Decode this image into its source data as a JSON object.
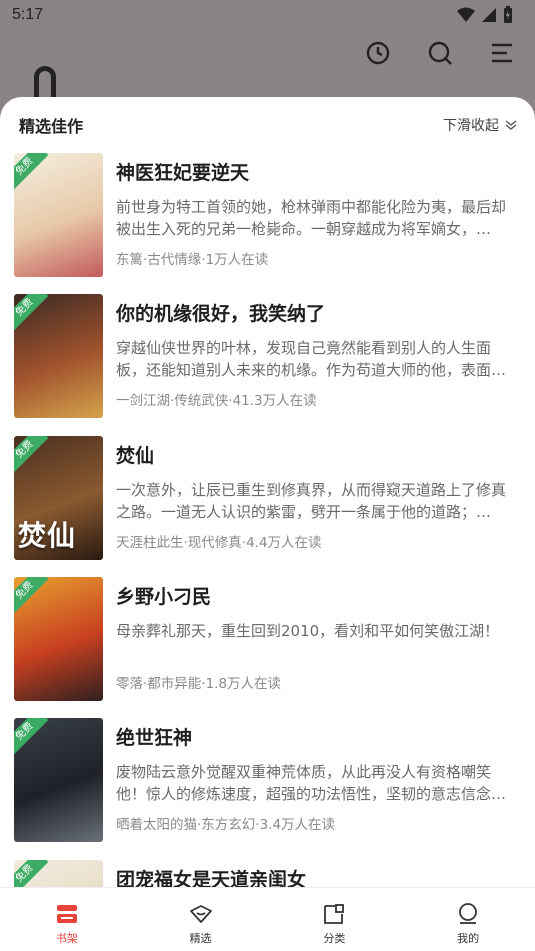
{
  "status_bar": {
    "time": "5:17"
  },
  "sheet": {
    "title": "精选佳作",
    "collapse_label": "下滑收起"
  },
  "books": [
    {
      "title": "神医狂妃要逆天",
      "description": "前世身为特工首领的她，枪林弹雨中都能化险为夷，最后却被出生入死的兄弟一枪毙命。一朝穿越成为将军嫡女，…",
      "meta": "东篱·古代情缘·1万人在读",
      "badge": "免费",
      "cover_text": "",
      "cover_colors": [
        "#f4efe0",
        "#e8c9a8",
        "#c25a5a"
      ]
    },
    {
      "title": "你的机缘很好，我笑纳了",
      "description": "穿越仙侠世界的叶林，发现自己竟然能看到别人的人生面板，还能知道别人未来的机缘。作为苟道大师的他，表面…",
      "meta": "一剑江湖·传统武侠·41.3万人在读",
      "badge": "免费",
      "cover_text": "",
      "cover_colors": [
        "#3b2a24",
        "#a0522d",
        "#d4a24c"
      ]
    },
    {
      "title": "焚仙",
      "description": "一次意外，让辰已重生到修真界，从而得窥天道路上了修真之路。一道无人认识的紫雷，劈开一条属于他的道路；…",
      "meta": "天涯柱此生·现代修真·4.4万人在读",
      "badge": "免费",
      "cover_text": "焚仙",
      "cover_colors": [
        "#4a3020",
        "#8a5a30",
        "#2a1a12"
      ]
    },
    {
      "title": "乡野小刁民",
      "description": "母亲葬礼那天，重生回到2010，看刘和平如何笑傲江湖！",
      "meta": "零落·都市异能·1.8万人在读",
      "badge": "免费",
      "cover_text": "",
      "cover_colors": [
        "#e8a030",
        "#c84020",
        "#302020"
      ]
    },
    {
      "title": "绝世狂神",
      "description": "废物陆云意外觉醒双重神荒体质，从此再没人有资格嘲笑他！惊人的修炼速度，超强的功法悟性，坚韧的意志信念…",
      "meta": "晒着太阳的猫·东方玄幻·3.4万人在读",
      "badge": "免费",
      "cover_text": "",
      "cover_colors": [
        "#3a4048",
        "#1e2228",
        "#6a7078"
      ]
    },
    {
      "title": "团宠福女是天道亲闺女",
      "description": "",
      "meta": "",
      "badge": "免费",
      "cover_text": "",
      "cover_colors": [
        "#f2ece0",
        "#e6d8c0",
        "#d0b890"
      ]
    }
  ],
  "bottom_nav": [
    {
      "label": "书架",
      "icon": "bookshelf-icon",
      "active": true
    },
    {
      "label": "精选",
      "icon": "featured-icon",
      "active": false
    },
    {
      "label": "分类",
      "icon": "category-icon",
      "active": false
    },
    {
      "label": "我的",
      "icon": "profile-icon",
      "active": false
    }
  ],
  "colors": {
    "accent": "#e8443c",
    "badge_green": "#3cab64",
    "overlay": "#8a8584"
  }
}
